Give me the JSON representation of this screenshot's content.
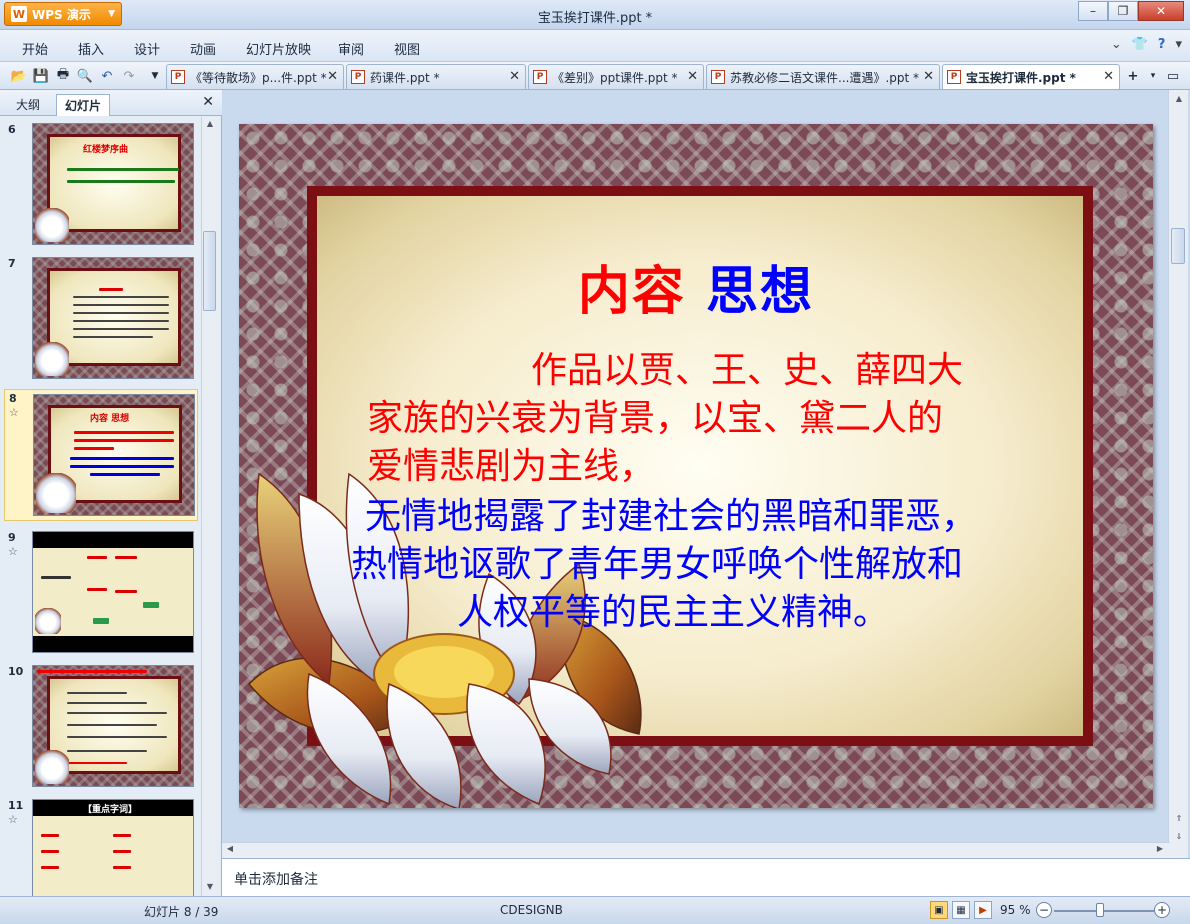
{
  "app": {
    "button_label": "WPS 演示",
    "window_title": "宝玉挨打课件.ppt *"
  },
  "menu": {
    "items": [
      "开始",
      "插入",
      "设计",
      "动画",
      "幻灯片放映",
      "审阅",
      "视图"
    ]
  },
  "doc_tabs": [
    {
      "label": "《等待散场》p...件.ppt *"
    },
    {
      "label": "药课件.ppt *"
    },
    {
      "label": "《差别》ppt课件.ppt *"
    },
    {
      "label": "苏教必修二语文课件...遭遇》.ppt *"
    },
    {
      "label": "宝玉挨打课件.ppt *"
    }
  ],
  "panel": {
    "tab_outline": "大纲",
    "tab_slides": "幻灯片"
  },
  "thumbnails": [
    {
      "num": "6",
      "title": "红楼梦序曲"
    },
    {
      "num": "7"
    },
    {
      "num": "8",
      "title": "内容 思想"
    },
    {
      "num": "9"
    },
    {
      "num": "10"
    },
    {
      "num": "11",
      "title": "【重点字词】"
    }
  ],
  "slide": {
    "title_part1": "内容",
    "title_part2": "思想",
    "para1_line1": "作品以贾、王、史、薛四大",
    "para1_line2": "家族的兴衰为背景，以宝、黛二人的",
    "para1_line3": "爱情悲剧为主线，",
    "para2_line1": "无情地揭露了封建社会的黑暗和罪恶，",
    "para2_line2": "热情地讴歌了青年男女呼唤个性解放和",
    "para2_line3": "人权平等的民主主义精神。"
  },
  "notes": {
    "placeholder": "单击添加备注"
  },
  "status": {
    "slide_counter": "幻灯片 8 / 39",
    "theme": "CDESIGNB",
    "zoom": "95 %"
  },
  "colors": {
    "title_red": "#ff0000",
    "title_blue": "#0000ff",
    "frame": "#7b0f14",
    "wps_orange": "#f08a00"
  }
}
